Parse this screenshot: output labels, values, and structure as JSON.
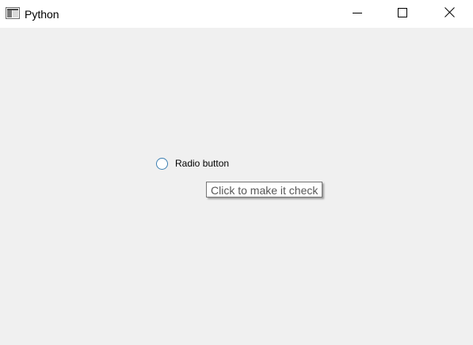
{
  "window": {
    "title": "Python",
    "app_icon": "window-app-icon",
    "controls": {
      "minimize_icon": "minimize-icon",
      "maximize_icon": "maximize-icon",
      "close_icon": "close-icon"
    }
  },
  "content": {
    "radio_button": {
      "label": "Radio button",
      "checked": false
    },
    "tooltip": {
      "text": "Click to make it check"
    }
  },
  "colors": {
    "window_background": "#f0f0f0",
    "titlebar_background": "#ffffff",
    "radio_border": "#3c7fb1",
    "tooltip_text": "#575757",
    "tooltip_border": "#767676"
  }
}
